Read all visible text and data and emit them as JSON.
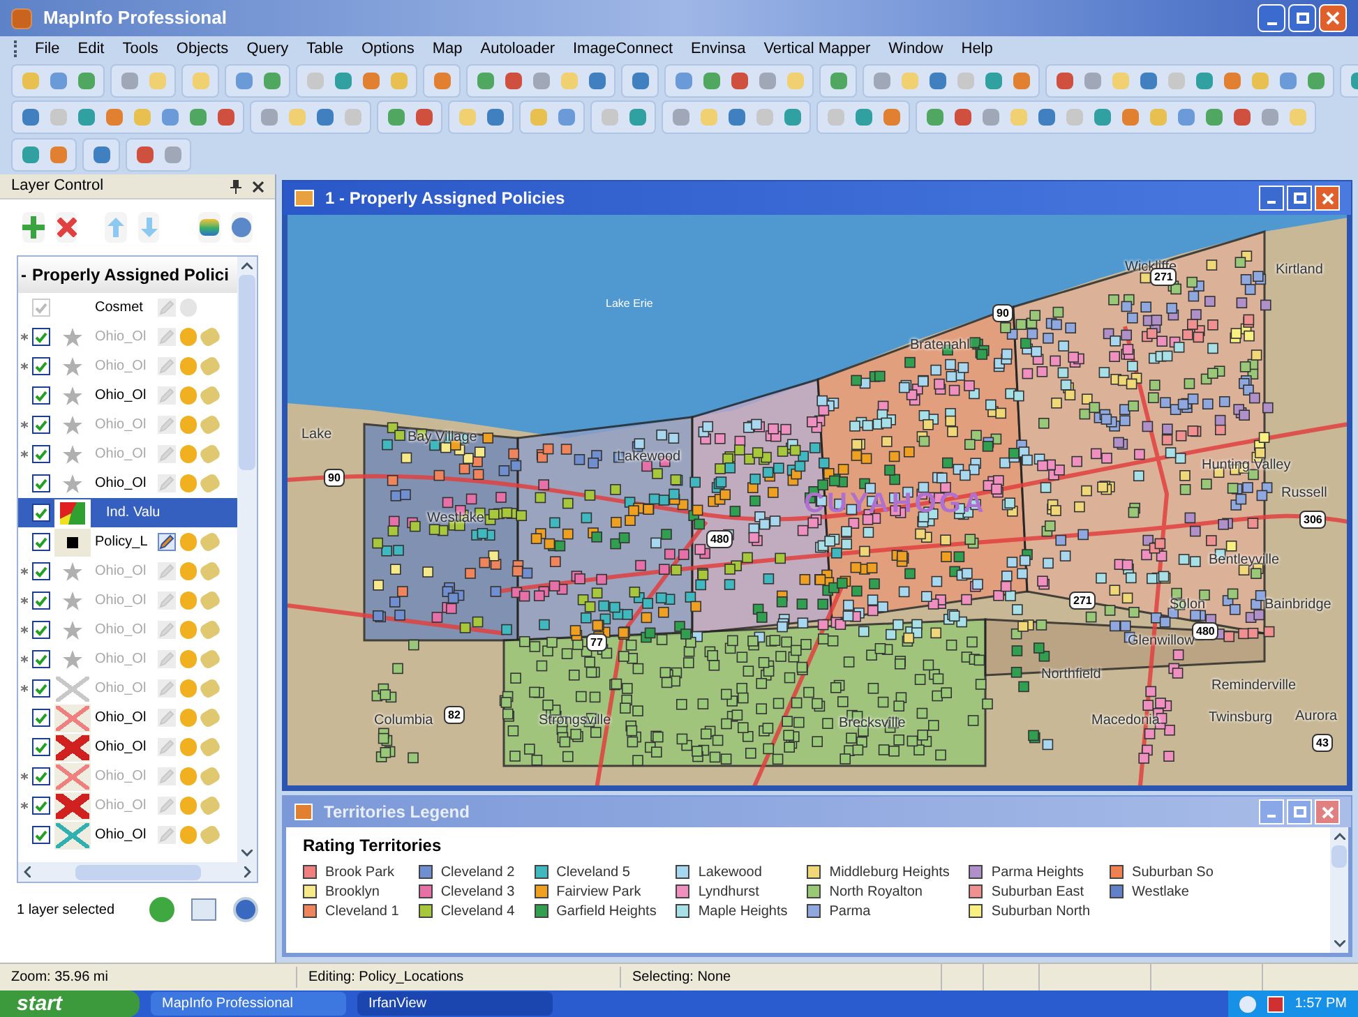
{
  "app": {
    "title": "MapInfo Professional"
  },
  "menu": [
    "File",
    "Edit",
    "Tools",
    "Objects",
    "Query",
    "Table",
    "Options",
    "Map",
    "Autoloader",
    "ImageConnect",
    "Envinsa",
    "Vertical Mapper",
    "Window",
    "Help"
  ],
  "layer_control": {
    "title": "Layer Control",
    "group": {
      "expander": "-",
      "name": "Properly Assigned Polici"
    },
    "layers": [
      {
        "kind": "cosmetic",
        "name": "Cosmet",
        "checked": true,
        "marked": false,
        "dimmed": false,
        "editable": false,
        "selected": false
      },
      {
        "kind": "star",
        "name": "Ohio_Ol",
        "checked": true,
        "marked": true,
        "dimmed": true,
        "editable": false,
        "selected": false
      },
      {
        "kind": "star",
        "name": "Ohio_Ol",
        "checked": true,
        "marked": true,
        "dimmed": true,
        "editable": false,
        "selected": false
      },
      {
        "kind": "star",
        "name": "Ohio_Ol",
        "checked": true,
        "marked": false,
        "dimmed": false,
        "editable": false,
        "selected": false
      },
      {
        "kind": "star",
        "name": "Ohio_Ol",
        "checked": true,
        "marked": true,
        "dimmed": true,
        "editable": false,
        "selected": false
      },
      {
        "kind": "star",
        "name": "Ohio_Ol",
        "checked": true,
        "marked": true,
        "dimmed": true,
        "editable": false,
        "selected": false
      },
      {
        "kind": "star",
        "name": "Ohio_Ol",
        "checked": true,
        "marked": false,
        "dimmed": false,
        "editable": false,
        "selected": false
      },
      {
        "kind": "thematic",
        "name": "Ind. Valu",
        "checked": true,
        "marked": false,
        "dimmed": false,
        "editable": false,
        "selected": true
      },
      {
        "kind": "symbol",
        "name": "Policy_L",
        "checked": true,
        "marked": false,
        "dimmed": false,
        "editable": true,
        "selected": false
      },
      {
        "kind": "star",
        "name": "Ohio_Ol",
        "checked": true,
        "marked": true,
        "dimmed": true,
        "editable": false,
        "selected": false
      },
      {
        "kind": "star",
        "name": "Ohio_Ol",
        "checked": true,
        "marked": true,
        "dimmed": true,
        "editable": false,
        "selected": false
      },
      {
        "kind": "star",
        "name": "Ohio_Ol",
        "checked": true,
        "marked": true,
        "dimmed": true,
        "editable": false,
        "selected": false
      },
      {
        "kind": "star",
        "name": "Ohio_Ol",
        "checked": true,
        "marked": true,
        "dimmed": true,
        "editable": false,
        "selected": false
      },
      {
        "kind": "cross",
        "color": "#c8c8c8",
        "name": "Ohio_Ol",
        "checked": true,
        "marked": true,
        "dimmed": true,
        "editable": false,
        "selected": false
      },
      {
        "kind": "cross",
        "color": "#f08080",
        "name": "Ohio_Ol",
        "checked": true,
        "marked": false,
        "dimmed": false,
        "editable": false,
        "selected": false
      },
      {
        "kind": "cross-bold",
        "color": "#d02020",
        "name": "Ohio_Ol",
        "checked": true,
        "marked": false,
        "dimmed": false,
        "editable": false,
        "selected": false
      },
      {
        "kind": "cross",
        "color": "#f08080",
        "name": "Ohio_Ol",
        "checked": true,
        "marked": true,
        "dimmed": true,
        "editable": false,
        "selected": false
      },
      {
        "kind": "cross-bold",
        "color": "#d02020",
        "name": "Ohio_Ol",
        "checked": true,
        "marked": true,
        "dimmed": true,
        "editable": false,
        "selected": false
      },
      {
        "kind": "cross",
        "color": "#30b0b0",
        "name": "Ohio_Ol",
        "checked": true,
        "marked": false,
        "dimmed": false,
        "editable": false,
        "selected": false
      }
    ],
    "footer": "1 layer selected"
  },
  "map_window": {
    "title": "1 - Properly Assigned Policies",
    "labels": [
      {
        "kind": "city",
        "text": "Wickliffe"
      },
      {
        "kind": "city",
        "text": "Kirtland"
      },
      {
        "kind": "shield",
        "text": "271"
      },
      {
        "kind": "water",
        "text": "Lake Erie"
      },
      {
        "kind": "shield",
        "text": "90"
      },
      {
        "kind": "city",
        "text": "Bratenahl"
      },
      {
        "kind": "city",
        "text": "Lake"
      },
      {
        "kind": "city",
        "text": "Bay Village"
      },
      {
        "kind": "city",
        "text": "Lakewood"
      },
      {
        "kind": "city",
        "text": "Hunting Valley"
      },
      {
        "kind": "shield",
        "text": "90"
      },
      {
        "kind": "county",
        "text": "CUYAHOGA"
      },
      {
        "kind": "city",
        "text": "Russell"
      },
      {
        "kind": "city",
        "text": "Westlake"
      },
      {
        "kind": "shield",
        "text": "306"
      },
      {
        "kind": "shield",
        "text": "480"
      },
      {
        "kind": "city",
        "text": "Bentleyville"
      },
      {
        "kind": "shield",
        "text": "271"
      },
      {
        "kind": "city",
        "text": "Solon"
      },
      {
        "kind": "city",
        "text": "Bainbridge"
      },
      {
        "kind": "shield",
        "text": "480"
      },
      {
        "kind": "city",
        "text": "Glenwillow"
      },
      {
        "kind": "shield",
        "text": "77"
      },
      {
        "kind": "city",
        "text": "Northfield"
      },
      {
        "kind": "city",
        "text": "Reminderville"
      },
      {
        "kind": "city",
        "text": "Columbia"
      },
      {
        "kind": "shield",
        "text": "82"
      },
      {
        "kind": "city",
        "text": "Strongsville"
      },
      {
        "kind": "city",
        "text": "Brecksville"
      },
      {
        "kind": "city",
        "text": "Macedonia"
      },
      {
        "kind": "city",
        "text": "Twinsburg"
      },
      {
        "kind": "city",
        "text": "Aurora"
      },
      {
        "kind": "shield",
        "text": "43"
      }
    ]
  },
  "legend_window": {
    "title": "Territories Legend",
    "heading": "Rating Territories",
    "items": [
      {
        "label": "Brook Park",
        "color": "#f08080"
      },
      {
        "label": "Brooklyn",
        "color": "#f5e98a"
      },
      {
        "label": "Cleveland 1",
        "color": "#f0845c"
      },
      {
        "label": "Cleveland 2",
        "color": "#6f8fd0"
      },
      {
        "label": "Cleveland 3",
        "color": "#e870a8"
      },
      {
        "label": "Cleveland 4",
        "color": "#a8c83c"
      },
      {
        "label": "Cleveland 5",
        "color": "#40b8c0"
      },
      {
        "label": "Fairview Park",
        "color": "#f0a020"
      },
      {
        "label": "Garfield Heights",
        "color": "#30a050"
      },
      {
        "label": "Lakewood",
        "color": "#a8d8f0"
      },
      {
        "label": "Lyndhurst",
        "color": "#f090c0"
      },
      {
        "label": "Maple Heights",
        "color": "#a8e0e8"
      },
      {
        "label": "Middleburg Heights",
        "color": "#f0d878"
      },
      {
        "label": "North Royalton",
        "color": "#98c878"
      },
      {
        "label": "Parma",
        "color": "#8fa8e0"
      },
      {
        "label": "Parma Heights",
        "color": "#b090c8"
      },
      {
        "label": "Suburban East",
        "color": "#f09090"
      },
      {
        "label": "Suburban North",
        "color": "#f8f080"
      },
      {
        "label": "Suburban So",
        "color": "#f08050"
      },
      {
        "label": "Westlake",
        "color": "#6080c8"
      }
    ]
  },
  "status_bar": {
    "zoom": "Zoom: 35.96 mi",
    "editing": "Editing: Policy_Locations",
    "selecting": "Selecting: None"
  },
  "taskbar": {
    "start": "start",
    "tasks": [
      {
        "label": "MapInfo Professional",
        "selected": false
      },
      {
        "label": "IrfanView",
        "selected": true
      }
    ],
    "clock": "1:57 PM"
  }
}
